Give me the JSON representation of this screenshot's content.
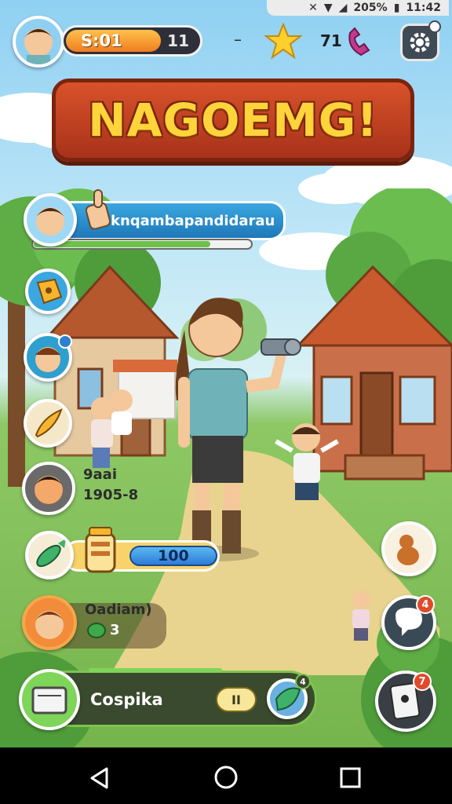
{
  "status_bar": {
    "battery": "205%",
    "time": "11:42"
  },
  "header": {
    "score_text": "S:01",
    "level_text": "11",
    "separator": "–",
    "currency_text": "71",
    "xp_fill": 0.72
  },
  "title": "NAGOEMG!",
  "quest_panel": {
    "name": "knqambapandidarau",
    "progress_fill": 0.82
  },
  "friend_card": {
    "name": "9aai",
    "id": "1905-8"
  },
  "energy_bar": {
    "value": "100"
  },
  "player_card": {
    "name": "Oadiam)",
    "count": "3"
  },
  "bottom_bar": {
    "label": "Cospika",
    "play_icon": "II",
    "badge_level": "4"
  },
  "right_buttons": {
    "chat_badge": "4",
    "inventory_badge": "7"
  },
  "colors": {
    "sky": "#8fd0f2",
    "grass": "#76b44d",
    "title_red": "#c8441f",
    "title_yellow": "#ffd43b",
    "xp_orange": "#f39a2c",
    "energy_blue": "#2e7bd8",
    "panel_blue": "#2a8fcf"
  }
}
